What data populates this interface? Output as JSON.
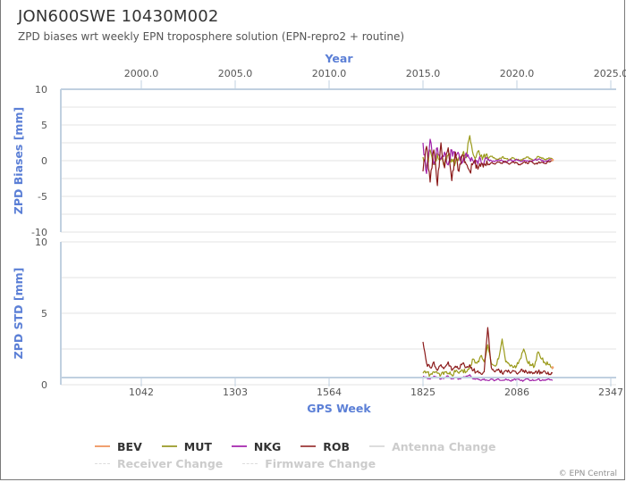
{
  "header": {
    "title": "JON600SWE 10430M002",
    "subtitle": "ZPD biases wrt weekly EPN troposphere solution (EPN-repro2 + routine)"
  },
  "credits": "© EPN Central",
  "colors": {
    "axis_title": "#5b7fd6",
    "axis_line": "#c0d0e0",
    "grid": "#e0e0e0",
    "BEV": "#f0a070",
    "MUT": "#9a9a1a",
    "NKG": "#a020a8",
    "ROB": "#8b1a1a"
  },
  "legend": [
    {
      "key": "BEV",
      "label": "BEV",
      "color": "#f0a070",
      "style": "solid",
      "active": true
    },
    {
      "key": "MUT",
      "label": "MUT",
      "color": "#a6a640",
      "style": "solid",
      "active": true
    },
    {
      "key": "NKG",
      "label": "NKG",
      "color": "#b040b8",
      "style": "solid",
      "active": true
    },
    {
      "key": "ROB",
      "label": "ROB",
      "color": "#a85050",
      "style": "solid",
      "active": true
    },
    {
      "key": "antenna",
      "label": "Antenna Change",
      "color": "#dddddd",
      "style": "solid",
      "active": false
    },
    {
      "key": "receiver",
      "label": "Receiver Change",
      "color": "#dddddd",
      "style": "dashed",
      "active": false
    },
    {
      "key": "firmware",
      "label": "Firmware Change",
      "color": "#dddddd",
      "style": "dashed",
      "active": false
    }
  ],
  "chart_data": [
    {
      "type": "line",
      "title": "ZPD Biases",
      "ylabel": "ZPD Biases [mm]",
      "xlabel_top": "Year",
      "ylim": [
        -10,
        10
      ],
      "yticks": [
        "10",
        "5",
        "0",
        "-5",
        "-10"
      ],
      "ytick_values": [
        10,
        5,
        0,
        -5,
        -10
      ],
      "grid": true,
      "top_axis": {
        "label": "Year",
        "ticks": [
          "2000.0",
          "2005.0",
          "2010.0",
          "2015.0",
          "2020.0",
          "2025.0"
        ],
        "tick_weeks": [
          1042,
          1303,
          1564,
          1825,
          2086,
          2347
        ]
      },
      "x_range_weeks": [
        890,
        2360
      ],
      "x": [
        1825,
        1835,
        1845,
        1855,
        1865,
        1875,
        1885,
        1895,
        1905,
        1915,
        1925,
        1935,
        1945,
        1955,
        1965,
        1975,
        1985,
        1995,
        2005,
        2015,
        2025,
        2035,
        2045,
        2055,
        2065,
        2075,
        2085,
        2095,
        2105,
        2115,
        2125,
        2135,
        2145,
        2155,
        2165,
        2175,
        2185
      ],
      "series": [
        {
          "name": "BEV",
          "values": [
            null,
            null,
            null,
            null,
            null,
            null,
            null,
            null,
            null,
            null,
            null,
            null,
            null,
            null,
            null,
            null,
            null,
            null,
            null,
            null,
            null,
            null,
            null,
            null,
            null,
            null,
            null,
            null,
            null,
            null,
            null,
            null,
            null,
            null,
            null,
            null,
            0.1
          ]
        },
        {
          "name": "MUT",
          "values": [
            0.5,
            -1.0,
            1.5,
            -0.5,
            1.0,
            0.3,
            -0.4,
            0.8,
            0.2,
            -0.3,
            0.5,
            0.9,
            0.4,
            3.5,
            0.8,
            1.0,
            0.6,
            0.9,
            0.4,
            0.6,
            0.3,
            0.2,
            0.5,
            0.3,
            0.1,
            0.4,
            0.2,
            0.0,
            0.3,
            0.5,
            0.2,
            0.1,
            0.6,
            0.3,
            0.2,
            0.4,
            0.3
          ]
        },
        {
          "name": "NKG",
          "values": [
            2.5,
            -1.8,
            3.0,
            -0.5,
            1.8,
            0.2,
            1.2,
            -0.6,
            1.5,
            0.4,
            0.9,
            -0.2,
            1.1,
            0.3,
            -0.1,
            0.0,
            0.2,
            -0.2,
            0.1,
            0.0,
            -0.1,
            0.1,
            0.0,
            -0.2,
            0.1,
            0.0,
            0.2,
            -0.1,
            0.1,
            0.0,
            -0.1,
            0.1,
            0.2,
            0.0,
            -0.1,
            0.1,
            0.2
          ]
        },
        {
          "name": "ROB",
          "values": [
            -1.5,
            2.0,
            -3.0,
            1.5,
            -3.5,
            2.5,
            -1.0,
            1.8,
            -2.8,
            1.2,
            -1.5,
            0.8,
            -0.5,
            -1.5,
            -0.3,
            -0.6,
            -0.8,
            -0.4,
            -0.6,
            -0.3,
            -0.5,
            -0.2,
            -0.4,
            -0.1,
            -0.5,
            -0.2,
            -0.3,
            -0.6,
            -0.2,
            -0.4,
            -0.1,
            -0.5,
            -0.3,
            -0.2,
            -0.4,
            -0.1,
            0.0
          ]
        }
      ]
    },
    {
      "type": "line",
      "title": "ZPD STD",
      "ylabel": "ZPD STD [mm]",
      "xlabel": "GPS Week",
      "ylim": [
        0,
        10
      ],
      "yticks": [
        "10",
        "5",
        "0"
      ],
      "ytick_values": [
        10,
        5,
        0
      ],
      "grid": true,
      "bottom_axis": {
        "label": "GPS Week",
        "ticks": [
          "1042",
          "1303",
          "1564",
          "1825",
          "2086",
          "2347"
        ],
        "tick_weeks": [
          1042,
          1303,
          1564,
          1825,
          2086,
          2347
        ]
      },
      "x_range_weeks": [
        890,
        2360
      ],
      "x": [
        1825,
        1835,
        1845,
        1855,
        1865,
        1875,
        1885,
        1895,
        1905,
        1915,
        1925,
        1935,
        1945,
        1955,
        1965,
        1975,
        1985,
        1995,
        2005,
        2015,
        2025,
        2035,
        2045,
        2055,
        2065,
        2075,
        2085,
        2095,
        2105,
        2115,
        2125,
        2135,
        2145,
        2155,
        2165,
        2175,
        2185
      ],
      "series": [
        {
          "name": "BEV",
          "values": [
            null,
            null,
            null,
            null,
            null,
            null,
            null,
            null,
            null,
            null,
            null,
            null,
            null,
            null,
            null,
            null,
            null,
            null,
            null,
            null,
            null,
            null,
            null,
            null,
            null,
            null,
            null,
            null,
            null,
            null,
            null,
            null,
            null,
            null,
            null,
            null,
            1.2
          ]
        },
        {
          "name": "MUT",
          "values": [
            0.8,
            0.9,
            0.7,
            0.9,
            0.8,
            0.7,
            0.9,
            0.8,
            0.7,
            0.9,
            0.8,
            1.0,
            0.9,
            1.2,
            1.8,
            1.5,
            2.0,
            1.6,
            2.8,
            1.5,
            1.3,
            1.8,
            3.2,
            1.6,
            1.4,
            1.2,
            1.3,
            1.8,
            2.5,
            1.6,
            1.4,
            1.3,
            2.3,
            1.8,
            1.5,
            1.4,
            1.1
          ]
        },
        {
          "name": "NKG",
          "values": [
            0.6,
            0.5,
            0.4,
            0.6,
            0.5,
            0.4,
            0.5,
            0.6,
            0.4,
            0.5,
            0.4,
            0.5,
            0.6,
            0.7,
            0.4,
            0.4,
            0.3,
            0.4,
            0.3,
            0.4,
            0.3,
            0.4,
            0.3,
            0.4,
            0.3,
            0.3,
            0.4,
            0.3,
            0.3,
            0.4,
            0.3,
            0.3,
            0.4,
            0.3,
            0.3,
            0.4,
            0.3
          ]
        },
        {
          "name": "ROB",
          "values": [
            3.0,
            1.5,
            1.2,
            1.6,
            1.0,
            1.4,
            1.2,
            1.6,
            1.0,
            1.3,
            1.1,
            1.5,
            1.2,
            1.4,
            1.0,
            0.9,
            0.8,
            0.9,
            4.0,
            1.2,
            0.9,
            1.1,
            0.8,
            1.0,
            0.9,
            1.0,
            0.8,
            0.9,
            1.0,
            0.8,
            0.9,
            0.8,
            0.9,
            0.8,
            0.9,
            0.7,
            0.8
          ]
        }
      ]
    }
  ]
}
